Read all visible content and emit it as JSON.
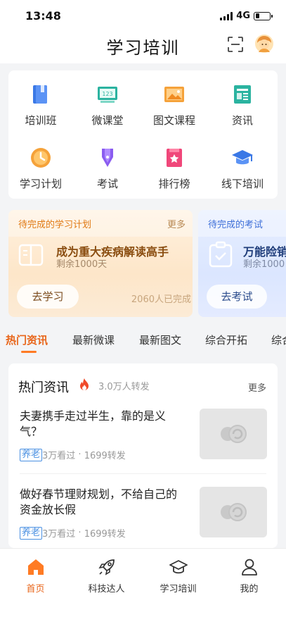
{
  "status": {
    "time": "13:48",
    "network": "4G"
  },
  "header": {
    "title": "学习培训",
    "scan_icon": "scan-icon",
    "avatar_icon": "avatar-icon"
  },
  "grid": [
    {
      "label": "培训班",
      "icon": "book-icon",
      "color": "#3a78e6"
    },
    {
      "label": "微课堂",
      "icon": "board-icon",
      "color": "#2bb3a0"
    },
    {
      "label": "图文课程",
      "icon": "picture-icon",
      "color": "#f5a23a"
    },
    {
      "label": "资讯",
      "icon": "news-icon",
      "color": "#2bb3a0"
    },
    {
      "label": "学习计划",
      "icon": "clock-icon",
      "color": "#f5a23a"
    },
    {
      "label": "考试",
      "icon": "pen-icon",
      "color": "#8a5cf0"
    },
    {
      "label": "排行榜",
      "icon": "ranking-icon",
      "color": "#f0477a"
    },
    {
      "label": "线下培训",
      "icon": "graduation-cap-icon",
      "color": "#3a78e6"
    }
  ],
  "study_card": {
    "header": "待完成的学习计划",
    "more": "更多",
    "title": "成为重大疾病解读高手",
    "remaining": "剩余1000天",
    "button": "去学习",
    "count": "2060人已完成"
  },
  "exam_card": {
    "header": "待完成的考试",
    "title": "万能险销",
    "remaining": "剩余1000",
    "button": "去考试"
  },
  "tabs": [
    "热门资讯",
    "最新微课",
    "最新图文",
    "综合开拓",
    "综合"
  ],
  "news": {
    "title": "热门资讯",
    "reposts": "3.0万人转发",
    "more": "更多",
    "items": [
      {
        "title": "夫妻携手走过半生，靠的是义气？",
        "tag": "养老",
        "views": "3万看过",
        "reposts": "1699转发"
      },
      {
        "title": "做好春节理财规划，不给自己的资金放长假",
        "tag": "养老",
        "views": "3万看过",
        "reposts": "1699转发"
      }
    ]
  },
  "nav": [
    {
      "label": "首页",
      "icon": "home-icon"
    },
    {
      "label": "科技达人",
      "icon": "rocket-icon"
    },
    {
      "label": "学习培训",
      "icon": "graduation-cap-icon"
    },
    {
      "label": "我的",
      "icon": "user-icon"
    }
  ],
  "colors": {
    "accent": "#e8651a",
    "tag": "#4a90e2"
  }
}
